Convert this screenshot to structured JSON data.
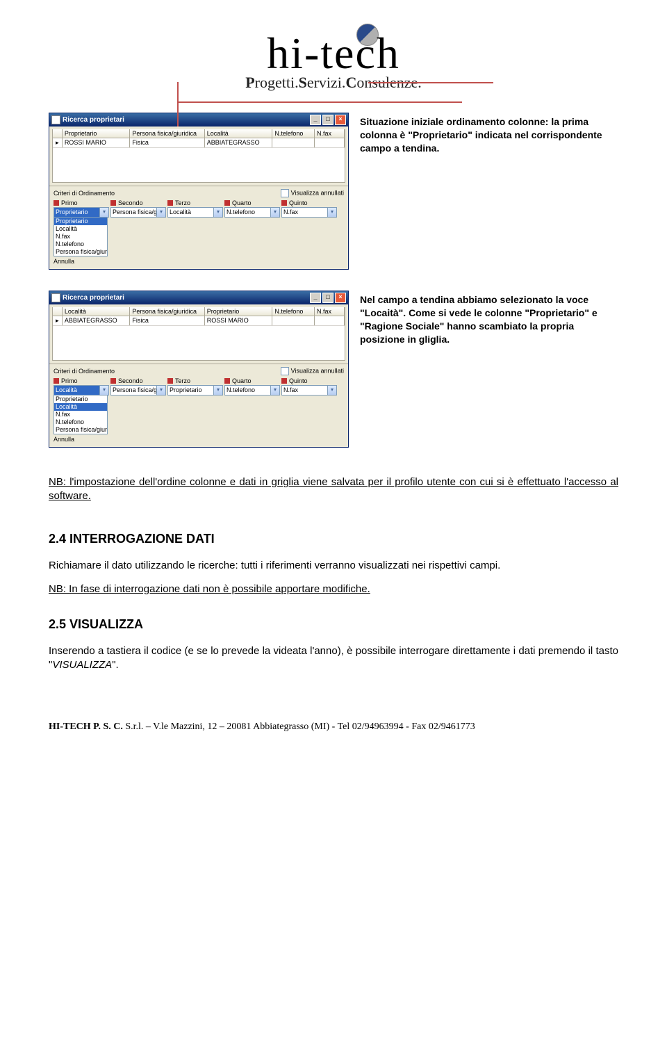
{
  "logo": {
    "main": "hi-tech",
    "sub_p": "P",
    "sub_rog": "rogetti.",
    "sub_s": "S",
    "sub_erv": "ervizi.",
    "sub_c": "C",
    "sub_ons": "onsulenze."
  },
  "shot1": {
    "title": "Ricerca proprietari",
    "headers": [
      "Proprietario",
      "Persona fisica/giuridica",
      "Località",
      "N.telefono",
      "N.fax"
    ],
    "row": [
      "ROSSI MARIO",
      "Fisica",
      "ABBIATEGRASSO",
      "",
      ""
    ],
    "criteri_label": "Criteri di Ordinamento",
    "vis_label": "Visualizza annullati",
    "orders": [
      "Primo",
      "Secondo",
      "Terzo",
      "Quarto",
      "Quinto"
    ],
    "dropdowns": [
      "Proprietario",
      "Persona fisica/giuri",
      "Località",
      "N.telefono",
      "N.fax"
    ],
    "openlist": [
      "Proprietario",
      "Località",
      "N.fax",
      "N.telefono",
      "Persona fisica/giuridica"
    ],
    "annulla": "Annulla"
  },
  "caption1": "Situazione iniziale ordinamento colonne: la prima colonna è \"Proprietario\" indicata nel corrispondente campo a tendina.",
  "shot2": {
    "title": "Ricerca proprietari",
    "headers": [
      "Località",
      "Persona fisica/giuridica",
      "Proprietario",
      "N.telefono",
      "N.fax"
    ],
    "row": [
      "ABBIATEGRASSO",
      "Fisica",
      "ROSSI MARIO",
      "",
      ""
    ],
    "criteri_label": "Criteri di Ordinamento",
    "vis_label": "Visualizza annullati",
    "orders": [
      "Primo",
      "Secondo",
      "Terzo",
      "Quarto",
      "Quinto"
    ],
    "dropdowns": [
      "Località",
      "Persona fisica/giuri",
      "Proprietario",
      "N.telefono",
      "N.fax"
    ],
    "openlist": [
      "Proprietario",
      "Località",
      "N.fax",
      "N.telefono",
      "Persona fisica/giuridica"
    ],
    "annulla": "Annulla"
  },
  "caption2": "Nel campo a tendina abbiamo selezionato la voce \"Locaità\". Come si vede le colonne \"Proprietario\" e \"Ragione Sociale\" hanno scambiato la propria posizione in gliglia.",
  "nb1": "NB: l'impostazione dell'ordine colonne e dati in griglia viene salvata per il profilo utente con cui si è effettuato l'accesso al software.",
  "sec24_title": "2.4 INTERROGAZIONE DATI",
  "sec24_p1": "Richiamare il dato utilizzando le ricerche: tutti i riferimenti verranno visualizzati nei rispettivi campi.",
  "sec24_p2": "NB: In fase di interrogazione dati non è possibile apportare modifiche.",
  "sec25_title": "2.5 VISUALIZZA",
  "sec25_p1a": "Inserendo a tastiera il codice (e se lo prevede la videata l'anno), è possibile interrogare direttamente i dati premendo il tasto \"",
  "sec25_p1b": "VISUALIZZA",
  "sec25_p1c": "\".",
  "footer": {
    "bold": "HI-TECH  P. S. C.",
    "rest": "  S.r.l. – V.le Mazzini, 12 – 20081 Abbiategrasso (MI)  -  Tel 02/94963994  -  Fax 02/9461773"
  }
}
